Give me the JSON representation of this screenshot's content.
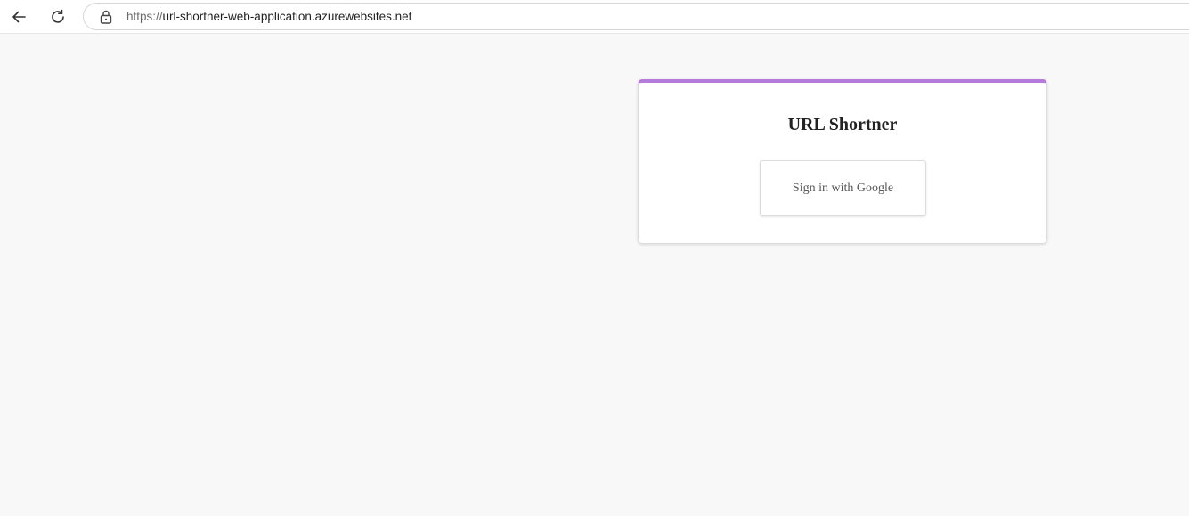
{
  "browser": {
    "url_scheme": "https://",
    "url_host": "url-shortner-web-application.azurewebsites.net",
    "icons": {
      "back": "arrow-left-icon",
      "reload": "reload-icon",
      "lock": "lock-icon"
    }
  },
  "card": {
    "title": "URL Shortner",
    "signin_label": "Sign in with Google",
    "accent_color": "#b57bdc"
  }
}
